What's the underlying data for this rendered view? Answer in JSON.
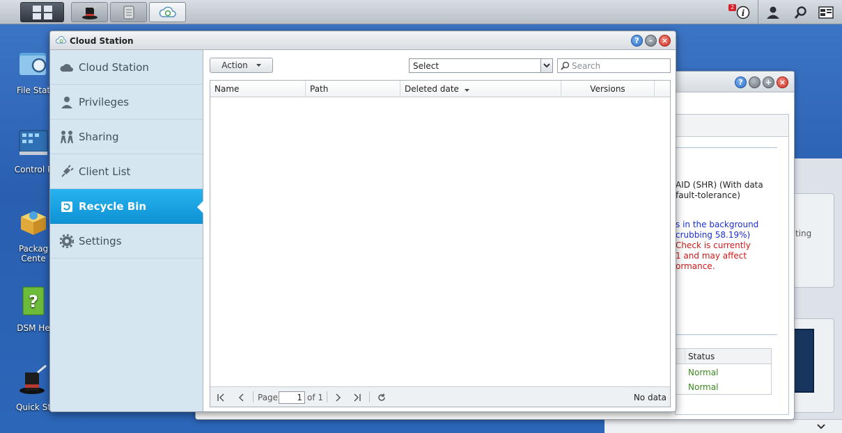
{
  "taskbar": {
    "notification_count": "2",
    "buttons": [
      "main-menu",
      "quick-start",
      "storage-manager",
      "cloud-station"
    ]
  },
  "desktop": {
    "icons": [
      {
        "label": "File Stat",
        "name": "file-station-icon"
      },
      {
        "label": "Control P",
        "name": "control-panel-icon"
      },
      {
        "label": "Packag Cente",
        "label_line1": "Packag",
        "label_line2": "Cente",
        "name": "package-center-icon"
      },
      {
        "label": "DSM He",
        "name": "dsm-help-icon"
      },
      {
        "label": "Quick St",
        "name": "quick-start-icon"
      }
    ]
  },
  "background_window": {
    "text_raid_line1": "AID (SHR) (With data",
    "text_raid_line2": "fault-tolerance)",
    "text_bg_line1": "s in the background",
    "text_bg_line2": "crubbing 58.19%)",
    "text_warn_line1": "Check is currently",
    "text_warn_line2": "1 and may affect",
    "text_warn_line3": "ormance.",
    "table_header": "Status",
    "rows": [
      "Normal",
      "Normal"
    ],
    "side_text": "ting"
  },
  "window": {
    "title": "Cloud Station",
    "sidebar": [
      {
        "label": "Cloud Station",
        "icon": "cloud-icon"
      },
      {
        "label": "Privileges",
        "icon": "user-icon"
      },
      {
        "label": "Sharing",
        "icon": "people-icon"
      },
      {
        "label": "Client List",
        "icon": "plug-icon"
      },
      {
        "label": "Recycle Bin",
        "icon": "recycle-icon",
        "active": true
      },
      {
        "label": "Settings",
        "icon": "gear-icon"
      }
    ],
    "toolbar": {
      "action_label": "Action",
      "select_value": "Select",
      "search_placeholder": "Search"
    },
    "grid": {
      "columns": [
        "Name",
        "Path",
        "Deleted date",
        "Versions"
      ],
      "sort_column": "Deleted date"
    },
    "pager": {
      "page_label": "Page",
      "page_value": "1",
      "of_label": "of 1",
      "status": "No data"
    }
  }
}
